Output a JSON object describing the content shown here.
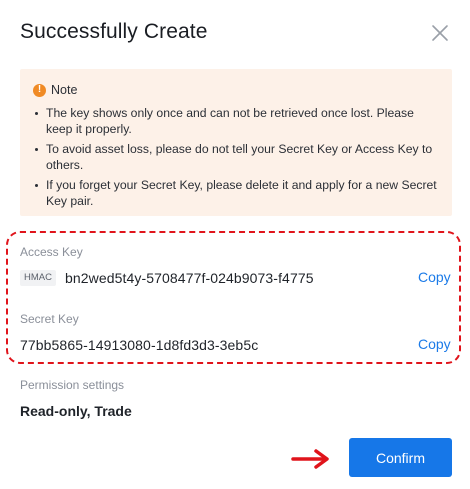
{
  "dialog": {
    "title": "Successfully Create",
    "close_icon": "close-icon"
  },
  "note": {
    "icon": "warning-icon",
    "icon_glyph": "!",
    "title": "Note",
    "items": [
      "The key shows only once and can not be retrieved once lost. Please keep it properly.",
      "To avoid asset loss, please do not tell your Secret Key or Access Key to others.",
      "If you forget your Secret Key, please delete it and apply for a new Secret Key pair."
    ]
  },
  "access_key": {
    "label": "Access Key",
    "tag": "HMAC",
    "value": "bn2wed5t4y-5708477f-024b9073-f4775",
    "copy_label": "Copy"
  },
  "secret_key": {
    "label": "Secret Key",
    "value": "77bb5865-14913080-1d8fd3d3-3eb5c",
    "copy_label": "Copy"
  },
  "permissions": {
    "label": "Permission settings",
    "value": "Read-only, Trade"
  },
  "actions": {
    "confirm_label": "Confirm"
  },
  "colors": {
    "accent": "#1677e8",
    "note_background": "#fdf1e8",
    "warning": "#f08a24",
    "highlight": "#e0141b"
  }
}
